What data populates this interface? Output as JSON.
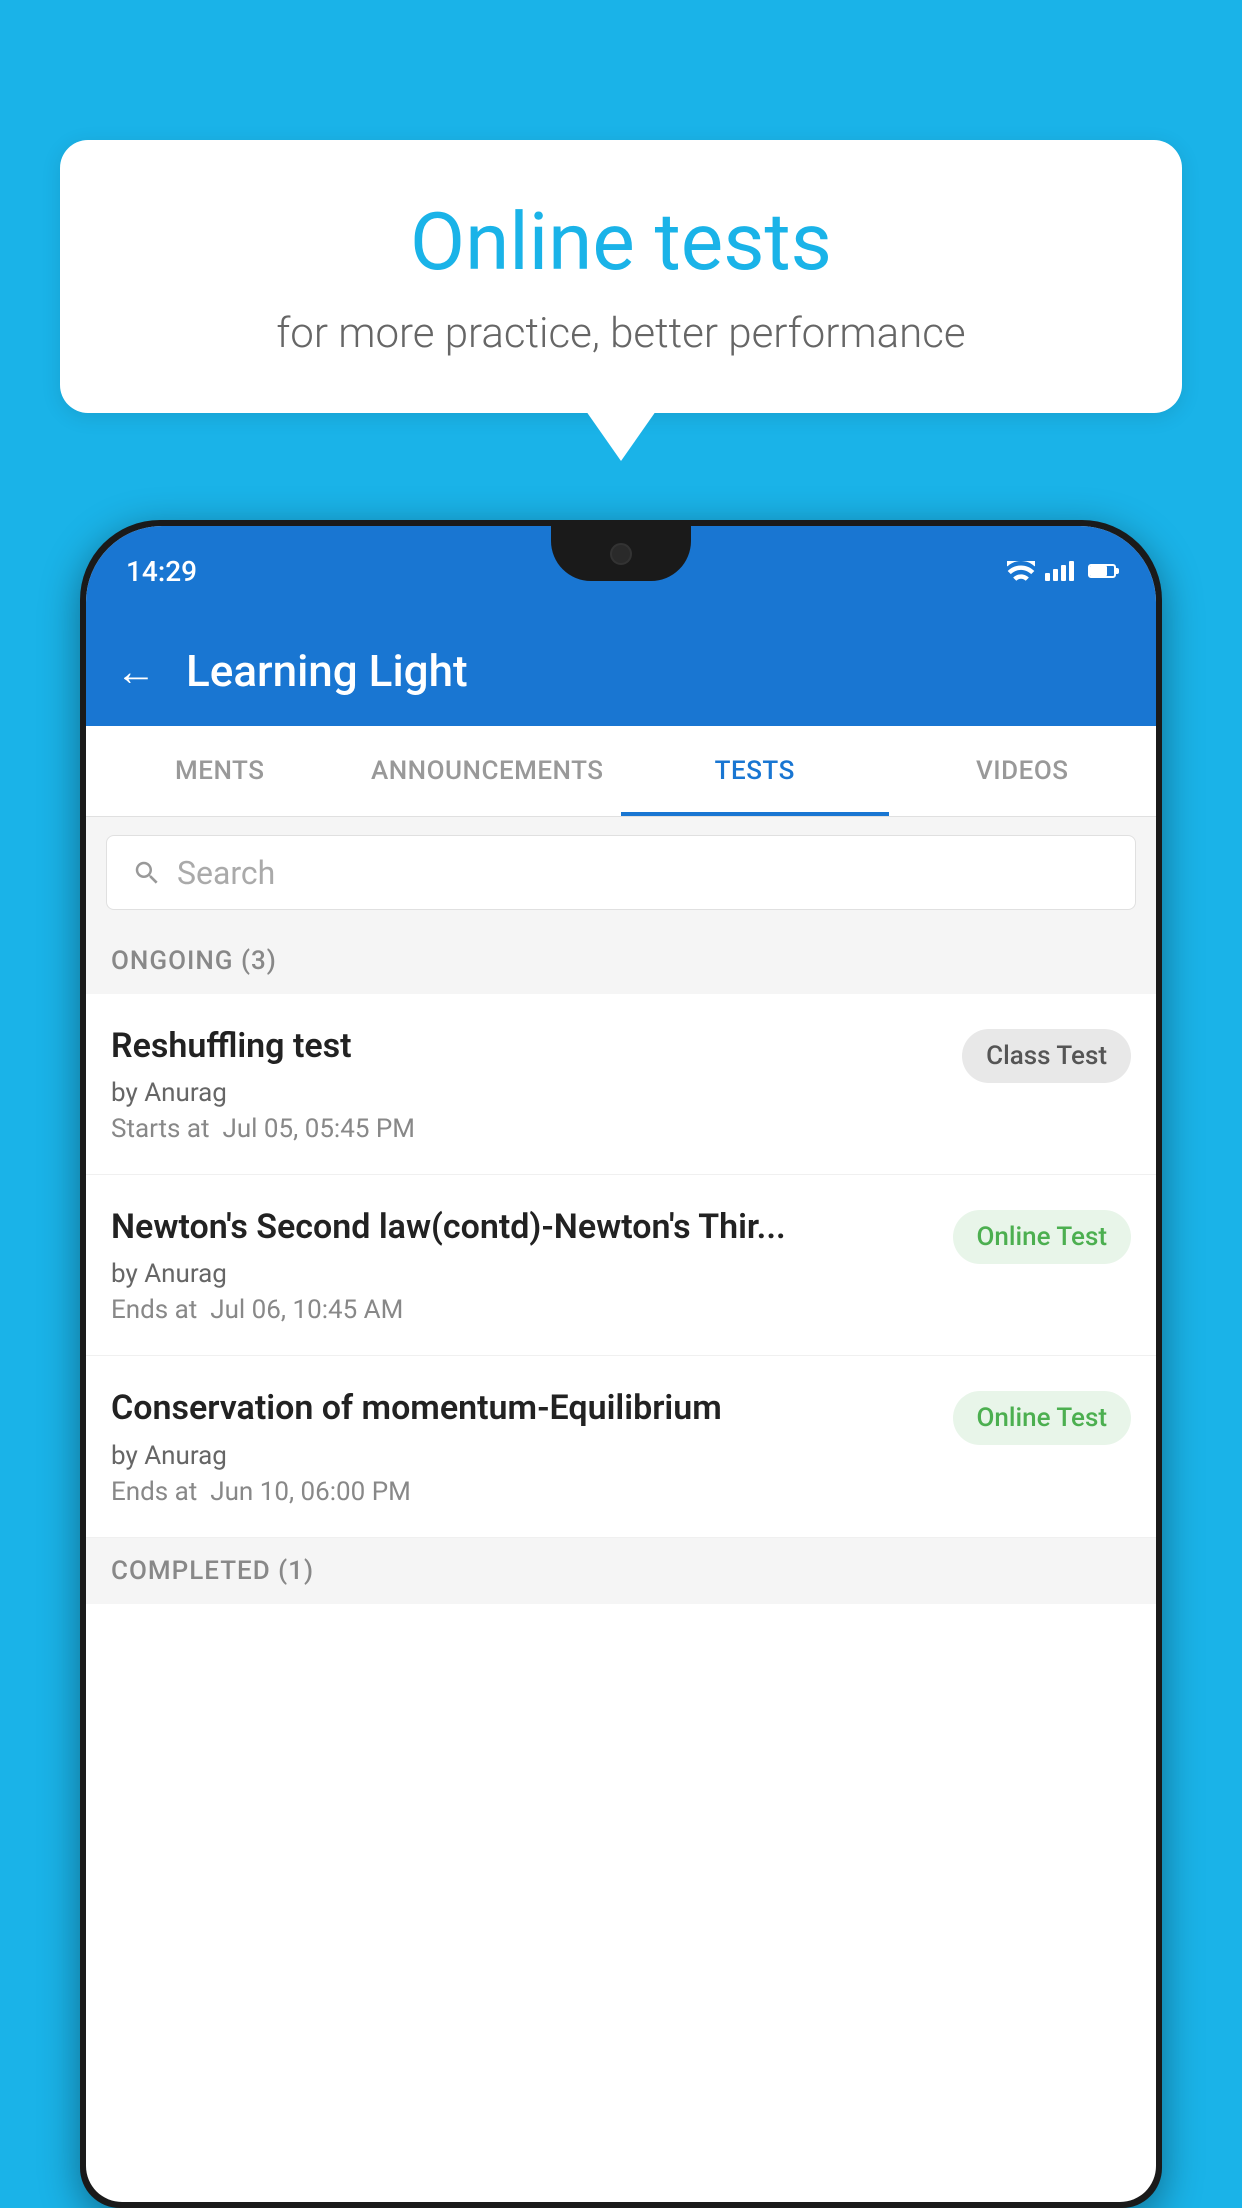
{
  "background_color": "#1ab3e8",
  "speech_bubble": {
    "title": "Online tests",
    "subtitle": "for more practice, better performance"
  },
  "status_bar": {
    "time": "14:29"
  },
  "app_bar": {
    "title": "Learning Light",
    "back_label": "←"
  },
  "tabs": [
    {
      "label": "MENTS",
      "active": false
    },
    {
      "label": "ANNOUNCEMENTS",
      "active": false
    },
    {
      "label": "TESTS",
      "active": true
    },
    {
      "label": "VIDEOS",
      "active": false
    }
  ],
  "search": {
    "placeholder": "Search"
  },
  "ongoing_section": {
    "label": "ONGOING (3)"
  },
  "tests": [
    {
      "title": "Reshuffling test",
      "author": "by Anurag",
      "time_label": "Starts at",
      "time": "Jul 05, 05:45 PM",
      "badge": "Class Test",
      "badge_type": "class"
    },
    {
      "title": "Newton's Second law(contd)-Newton's Thir...",
      "author": "by Anurag",
      "time_label": "Ends at",
      "time": "Jul 06, 10:45 AM",
      "badge": "Online Test",
      "badge_type": "online"
    },
    {
      "title": "Conservation of momentum-Equilibrium",
      "author": "by Anurag",
      "time_label": "Ends at",
      "time": "Jun 10, 06:00 PM",
      "badge": "Online Test",
      "badge_type": "online"
    }
  ],
  "completed_section": {
    "label": "COMPLETED (1)"
  }
}
